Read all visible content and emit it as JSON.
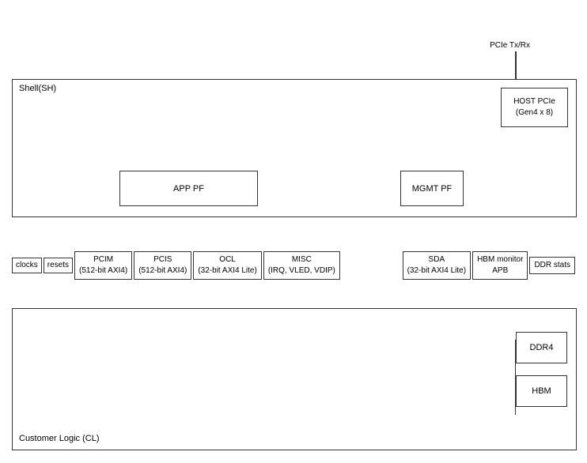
{
  "diagram": {
    "pcie_txrx": "PCIe Tx/Rx",
    "shell_label": "Shell(SH)",
    "host_pcie": "HOST PCIe\n(Gen4 x 8)",
    "host_pcie_line1": "HOST PCIe",
    "host_pcie_line2": "(Gen4 x 8)",
    "app_pf": "APP PF",
    "mgmt_pf": "MGMT PF",
    "cl_label": "Customer Logic (CL)",
    "ddr4": "DDR4",
    "hbm": "HBM",
    "interfaces": [
      {
        "id": "clocks",
        "label": "clocks"
      },
      {
        "id": "resets",
        "label": "resets"
      },
      {
        "id": "pcim",
        "label": "PCIM\n(512-bit AXI4)",
        "line1": "PCIM",
        "line2": "(512-bit AXI4)"
      },
      {
        "id": "pcis",
        "label": "PCIS\n(512-bit AXI4)",
        "line1": "PCIS",
        "line2": "(512-bit AXI4)"
      },
      {
        "id": "ocl",
        "label": "OCL\n(32-bit AXI4 Lite)",
        "line1": "OCL",
        "line2": "(32-bit AXI4 Lite)"
      },
      {
        "id": "misc",
        "label": "MISC\n(IRQ, VLED, VDIP)",
        "line1": "MISC",
        "line2": "(IRQ, VLED, VDIP)"
      },
      {
        "id": "sda",
        "label": "SDA\n(32-bit AXI4 Lite)",
        "line1": "SDA",
        "line2": "(32-bit AXI4 Lite)"
      },
      {
        "id": "hbm_monitor",
        "label": "HBM monitor\nAPB",
        "line1": "HBM monitor",
        "line2": "APB"
      },
      {
        "id": "ddr_stats",
        "label": "DDR stats",
        "line1": "DDR stats",
        "line2": ""
      }
    ]
  }
}
